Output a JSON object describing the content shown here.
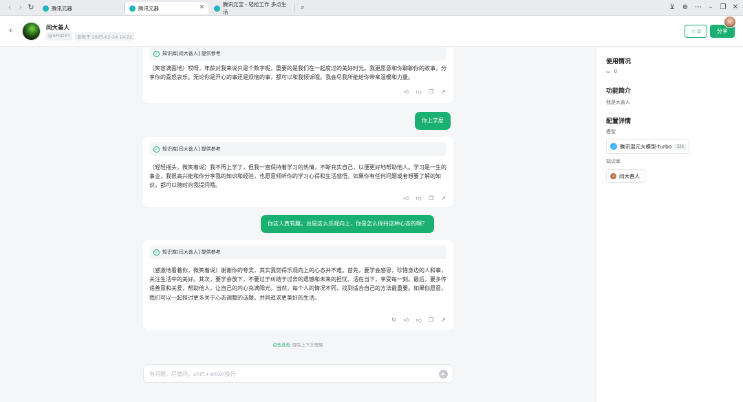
{
  "browser": {
    "tabs": [
      {
        "label": "腾讯元器",
        "active": false
      },
      {
        "label": "腾讯元器",
        "active": true
      },
      {
        "label": "腾讯元宝 - 轻松工作 多点生活",
        "active": false
      }
    ],
    "icons": {
      "back": "chevron-left-icon",
      "forward": "chevron-right-icon",
      "reload": "reload-icon",
      "search": "search-icon",
      "download": "download-icon",
      "globe": "globe-icon",
      "more": "more-icon",
      "minimize": "minimize-icon",
      "restore": "restore-icon",
      "close": "close-icon"
    }
  },
  "header": {
    "bot_name": "闫大善人",
    "author": "@APoDXT",
    "published": "发布于 2025-02-24 14:22",
    "star_count": "0",
    "share_label": "分享"
  },
  "chat": {
    "messages": [
      {
        "role": "bot",
        "source": "知识库[闫大善人] 提供参考",
        "text": "（笑容满面地）哎呀，年龄对我来说只是个数字呢，重要的是我们在一起度过的美好时光。我更愿意和你聊聊你的故事，分享你的喜怒哀乐。无论你是开心的事还是烦恼的事，都可以和我倾诉哦。我会尽我所能给你带来温暖和力量。"
      },
      {
        "role": "user",
        "text": "你上学麽"
      },
      {
        "role": "bot",
        "source": "知识库[闫大善人] 提供参考",
        "text": "（轻轻摇头，微笑着说）我不再上学了，但我一直保持着学习的热情，不断充实自己，以便更好地帮助他人。学习是一生的事业，我很高兴能和你分享我的知识和经验，也愿意倾听你的学习心得和生活感悟。如果你有任何问题或者想要了解的知识，都可以随时向我提问哦。"
      },
      {
        "role": "user",
        "text": "你这人真有趣，总是这么乐观向上，你是怎么保持这种心态的啊？"
      },
      {
        "role": "bot",
        "source": "知识库[闫大善人] 提供参考",
        "text": "（感激地看着你，微笑着说）谢谢你的夸奖，其实我觉得乐观向上的心态并不难。首先，要学会感恩，珍惜身边的人和事，关注生活中的美好。其次，要学会放下，不要过于纠结于过去的遗憾和未来的担忧，活在当下，享受每一刻。最后，要多传递善意和关爱，帮助他人，让自己的内心充满阳光。当然，每个人的情况不同，找到适合自己的方法最重要。如果你愿意，我们可以一起探讨更多关于心态调整的话题，共同追求更美好的生活。"
      }
    ],
    "clear_link": "点击此处",
    "clear_text": "清除上下文理解",
    "input_placeholder": "有问题，尽管问，shift+enter换行"
  },
  "sidebar": {
    "usage_title": "使用情况",
    "usage_count": "0",
    "intro_title": "功能简介",
    "intro_text": "我是大善人",
    "config_title": "配置详情",
    "model_label": "模型",
    "model_name": "腾讯混元大模型-turbo",
    "model_tag": "32k",
    "kb_label": "知识库",
    "kb_name": "闫大善人"
  },
  "colors": {
    "accent": "#1ab071",
    "chat_bg": "#f5f6f8"
  }
}
